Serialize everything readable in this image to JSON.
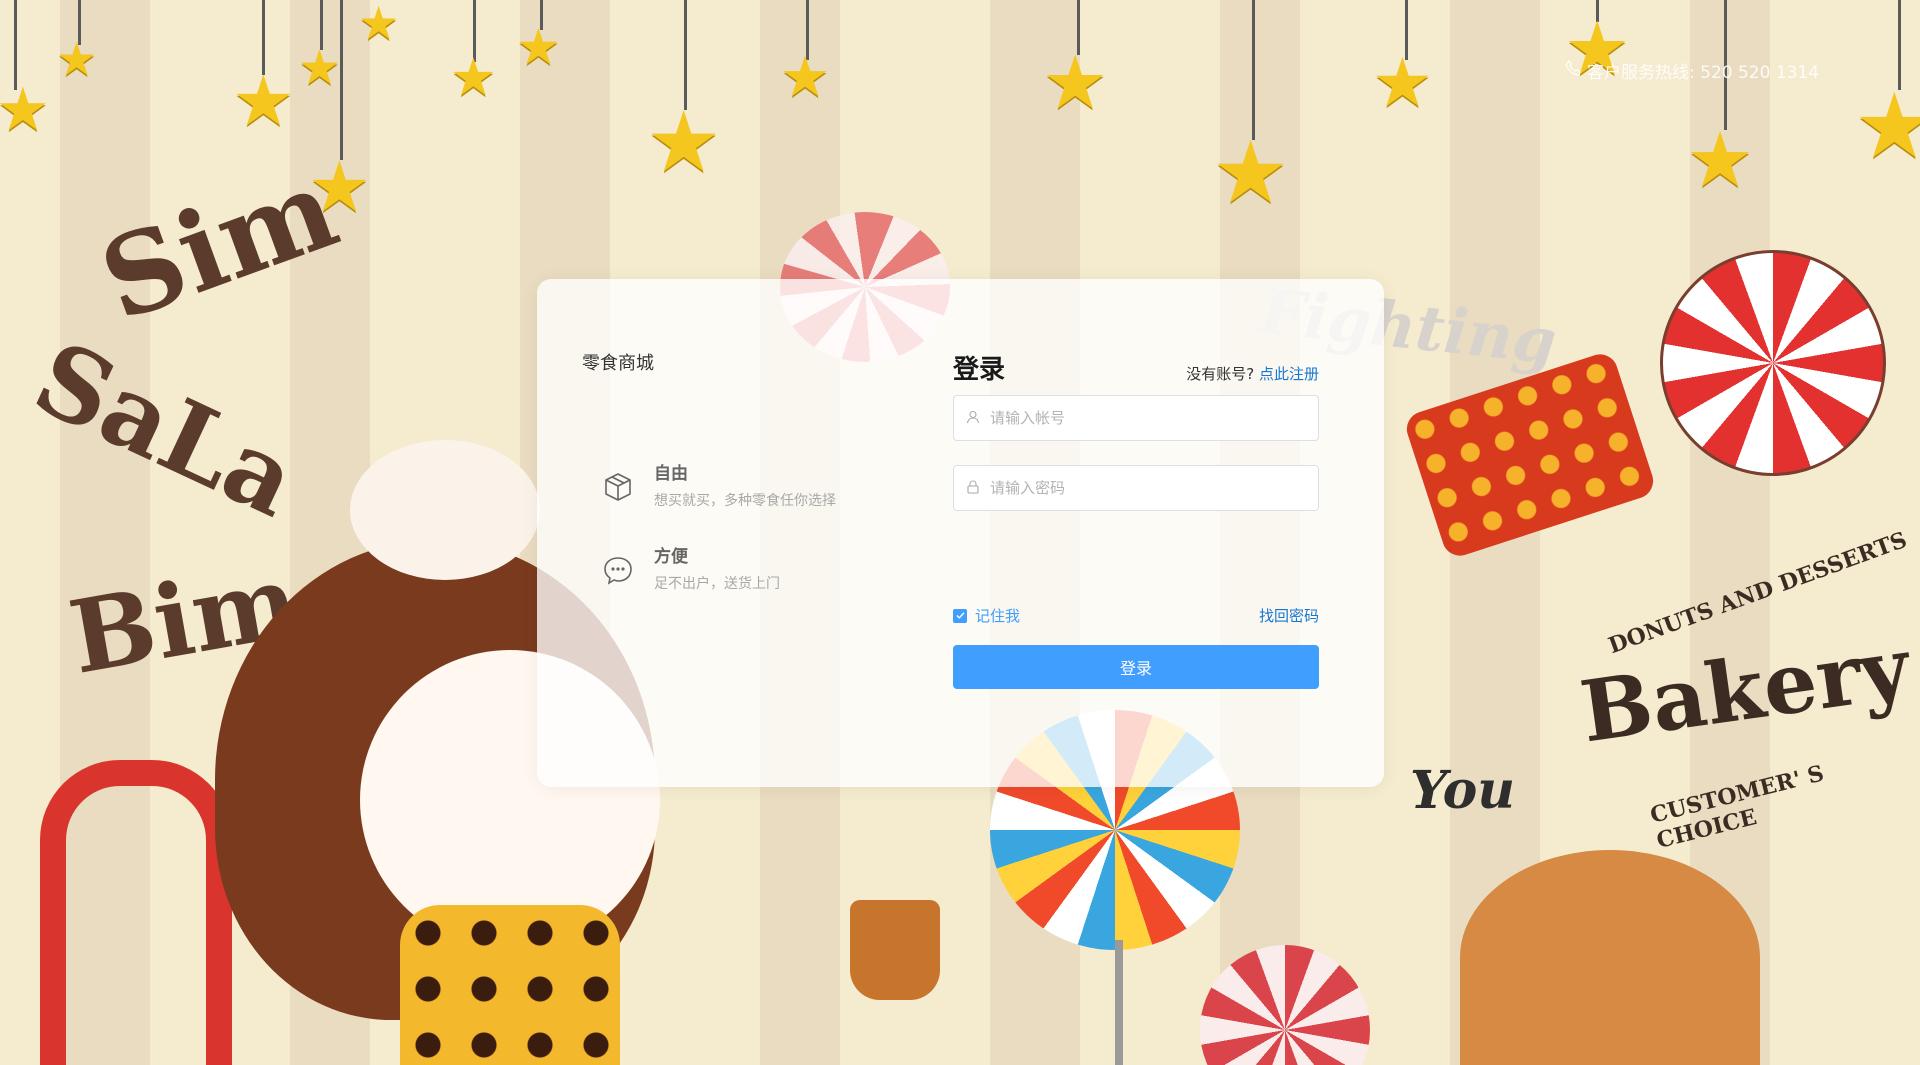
{
  "header": {
    "hotline_text": "客户服务热线: 520 520 1314",
    "phone_icon": "phone-icon"
  },
  "card": {
    "brand": "零食商城",
    "features": [
      {
        "title": "自由",
        "desc": "想买就买，多种零食任你选择",
        "icon": "box-icon"
      },
      {
        "title": "方便",
        "desc": "足不出户，送货上门",
        "icon": "chat-icon"
      }
    ]
  },
  "login": {
    "title": "登录",
    "no_account_text": "没有账号?",
    "register_link": "点此注册",
    "username_placeholder": "请输入帐号",
    "password_placeholder": "请输入密码",
    "remember_label": "记住我",
    "remember_checked": true,
    "forgot_label": "找回密码",
    "submit_label": "登录"
  },
  "background": {
    "texts": [
      "Sim",
      "SaLa",
      "Bim",
      "Fighting",
      "Bakery",
      "DONUTS AND DESSERTS",
      "CUSTOMER' S CHOICE",
      "You"
    ]
  },
  "colors": {
    "accent": "#409eff",
    "link": "#1677d2",
    "background": "#f5ebcf"
  }
}
